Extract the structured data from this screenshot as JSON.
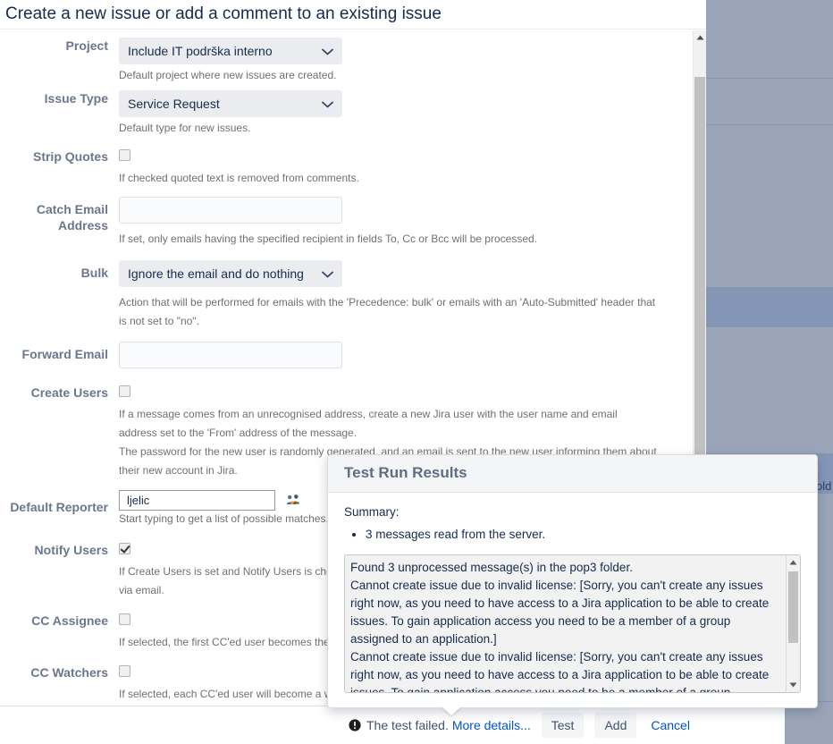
{
  "dialog": {
    "title": "Create a new issue or add a comment to an existing issue"
  },
  "form": {
    "fields": [
      {
        "label": "Project",
        "type": "select",
        "value": "Include IT podrška interno",
        "hint": "Default project where new issues are created."
      },
      {
        "label": "Issue Type",
        "type": "select",
        "value": "Service Request",
        "hint": "Default type for new issues."
      },
      {
        "label": "Strip Quotes",
        "type": "checkbox",
        "checked": false,
        "hint": "If checked quoted text is removed from comments."
      },
      {
        "label": "Catch Email Address",
        "type": "text",
        "value": "",
        "hint": "If set, only emails having the specified recipient in fields To, Cc or Bcc will be processed."
      },
      {
        "label": "Bulk",
        "type": "select",
        "value": "Ignore the email and do nothing",
        "hint": "Action that will be performed for emails with the 'Precedence: bulk' or emails with an 'Auto-Submitted' header that is not set to \"no\"."
      },
      {
        "label": "Forward Email",
        "type": "text",
        "value": "",
        "hint": ""
      },
      {
        "label": "Create Users",
        "type": "checkbox",
        "checked": false,
        "hint": "If a message comes from an unrecognised address, create a new Jira user with the user name and email address set to the 'From' address of the message.",
        "hint2": "The password for the new user is randomly generated, and an email is sent to the new user informing them about their new account in Jira."
      },
      {
        "label": "Default Reporter",
        "type": "userpicker",
        "value": "ljelic",
        "hint": "Start typing to get a list of possible matches."
      },
      {
        "label": "Notify Users",
        "type": "checkbox",
        "checked": true,
        "hint": "If Create Users is set and Notify Users is checked, the new users will be notified via email.",
        "hint_visible": "If Create Users is set and Notify Users is check",
        "hint_visible2": "via email."
      },
      {
        "label": "CC Assignee",
        "type": "checkbox",
        "checked": false,
        "hint": "If selected, the first CC'ed user becomes the assignee.",
        "hint_visible": "If selected, the first CC'ed user becomes the a"
      },
      {
        "label": "CC Watchers",
        "type": "checkbox",
        "checked": false,
        "hint": "If selected, each CC'ed user will become a watcher.",
        "hint_visible": "If selected, each CC'ed user will become a wat"
      }
    ]
  },
  "footer": {
    "status_text": "The test failed.",
    "more_details_label": "More details...",
    "test_label": "Test",
    "add_label": "Add",
    "cancel_label": "Cancel"
  },
  "test_popup": {
    "title": "Test Run Results",
    "summary_label": "Summary:",
    "summary_items": [
      "3 messages read from the server."
    ],
    "log": "Found 3 unprocessed message(s) in the pop3 folder.\nCannot create issue due to invalid license: [Sorry, you can't create any issues right now, as you need to have access to a Jira application to be able to create issues. To gain application access you need to be a member of a group assigned to an application.]\nCannot create issue due to invalid license: [Sorry, you can't create any issues right now, as you need to have access to a Jira application to be able to create issues. To gain application access you need to be a member of a group"
  },
  "background": {
    "partial_text": "old"
  },
  "colors": {
    "link": "#0052cc",
    "label": "#6b778c",
    "select_bg": "#ebecf0",
    "input_bg": "#fafbfc",
    "overlay_row": "#9aa5b9",
    "overlay_row_alt": "#8496b5",
    "error": "#172b4d"
  }
}
